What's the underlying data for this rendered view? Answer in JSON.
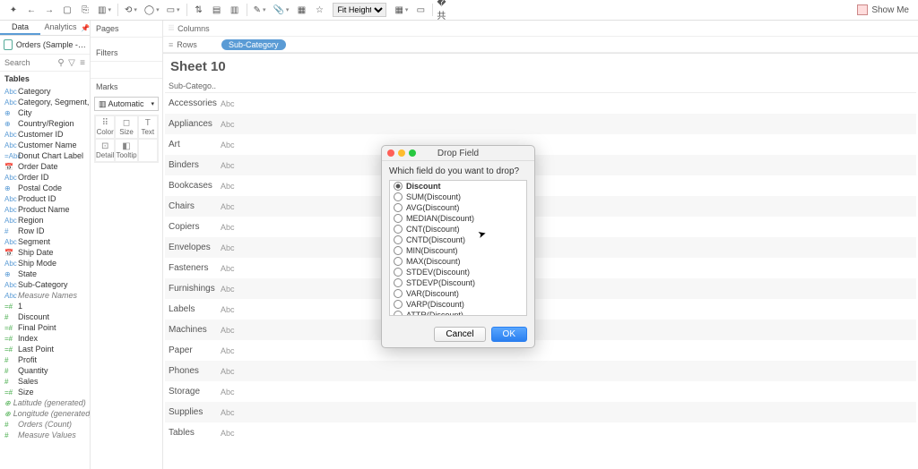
{
  "toolbar": {
    "fit_label": "Fit Height",
    "showme_label": "Show Me"
  },
  "side_tabs": {
    "data": "Data",
    "analytics": "Analytics"
  },
  "datasource": "Orders (Sample - Supe...",
  "search_placeholder": "Search",
  "tables_header": "Tables",
  "fields": [
    {
      "ic": "Abc",
      "t": "d",
      "n": "Category"
    },
    {
      "ic": "Abc",
      "t": "d",
      "n": "Category, Segment, Sub..."
    },
    {
      "ic": "⊕",
      "t": "geo",
      "n": "City"
    },
    {
      "ic": "⊕",
      "t": "geo",
      "n": "Country/Region"
    },
    {
      "ic": "Abc",
      "t": "d",
      "n": "Customer ID"
    },
    {
      "ic": "Abc",
      "t": "d",
      "n": "Customer Name"
    },
    {
      "ic": "=Abc",
      "t": "d",
      "n": "Donut Chart Label"
    },
    {
      "ic": "📅",
      "t": "d",
      "n": "Order Date"
    },
    {
      "ic": "Abc",
      "t": "d",
      "n": "Order ID"
    },
    {
      "ic": "⊕",
      "t": "geo",
      "n": "Postal Code"
    },
    {
      "ic": "Abc",
      "t": "d",
      "n": "Product ID"
    },
    {
      "ic": "Abc",
      "t": "d",
      "n": "Product Name"
    },
    {
      "ic": "Abc",
      "t": "d",
      "n": "Region"
    },
    {
      "ic": "#",
      "t": "d",
      "n": "Row ID"
    },
    {
      "ic": "Abc",
      "t": "d",
      "n": "Segment"
    },
    {
      "ic": "📅",
      "t": "d",
      "n": "Ship Date"
    },
    {
      "ic": "Abc",
      "t": "d",
      "n": "Ship Mode"
    },
    {
      "ic": "⊕",
      "t": "geo",
      "n": "State"
    },
    {
      "ic": "Abc",
      "t": "d",
      "n": "Sub-Category"
    },
    {
      "ic": "Abc",
      "t": "d",
      "n": "Measure Names",
      "it": true
    },
    {
      "ic": "=#",
      "t": "m",
      "n": "1"
    },
    {
      "ic": "#",
      "t": "m",
      "n": "Discount"
    },
    {
      "ic": "=#",
      "t": "m",
      "n": "Final Point"
    },
    {
      "ic": "=#",
      "t": "m",
      "n": "Index"
    },
    {
      "ic": "=#",
      "t": "m",
      "n": "Last Point"
    },
    {
      "ic": "#",
      "t": "m",
      "n": "Profit"
    },
    {
      "ic": "#",
      "t": "m",
      "n": "Quantity"
    },
    {
      "ic": "#",
      "t": "m",
      "n": "Sales"
    },
    {
      "ic": "=#",
      "t": "m",
      "n": "Size"
    },
    {
      "ic": "⊕",
      "t": "m",
      "n": "Latitude (generated)",
      "it": true
    },
    {
      "ic": "⊕",
      "t": "m",
      "n": "Longitude (generated)",
      "it": true
    },
    {
      "ic": "#",
      "t": "m",
      "n": "Orders (Count)",
      "it": true
    },
    {
      "ic": "#",
      "t": "m",
      "n": "Measure Values",
      "it": true
    }
  ],
  "pages_label": "Pages",
  "filters_label": "Filters",
  "marks_label": "Marks",
  "mark_type": "Automatic",
  "mark_cells": [
    {
      "i": "⠿",
      "l": "Color"
    },
    {
      "i": "◻",
      "l": "Size"
    },
    {
      "i": "T",
      "l": "Text"
    },
    {
      "i": "⊡",
      "l": "Detail"
    },
    {
      "i": "◧",
      "l": "Tooltip"
    },
    {
      "i": "",
      "l": ""
    }
  ],
  "columns_label": "Columns",
  "rows_label": "Rows",
  "row_pill": "Sub-Category",
  "sheet_title": "Sheet 10",
  "view_header": "Sub-Catego..",
  "view_rows": [
    "Accessories",
    "Appliances",
    "Art",
    "Binders",
    "Bookcases",
    "Chairs",
    "Copiers",
    "Envelopes",
    "Fasteners",
    "Furnishings",
    "Labels",
    "Machines",
    "Paper",
    "Phones",
    "Storage",
    "Supplies",
    "Tables"
  ],
  "abc": "Abc",
  "dialog": {
    "title": "Drop Field",
    "question": "Which field do you want to drop?",
    "options": [
      {
        "n": "Discount",
        "b": true,
        "s": true
      },
      {
        "n": "SUM(Discount)"
      },
      {
        "n": "AVG(Discount)"
      },
      {
        "n": "MEDIAN(Discount)"
      },
      {
        "n": "CNT(Discount)"
      },
      {
        "n": "CNTD(Discount)"
      },
      {
        "n": "MIN(Discount)"
      },
      {
        "n": "MAX(Discount)"
      },
      {
        "n": "STDEV(Discount)"
      },
      {
        "n": "STDEVP(Discount)"
      },
      {
        "n": "VAR(Discount)"
      },
      {
        "n": "VARP(Discount)"
      },
      {
        "n": "ATTR(Discount)"
      }
    ],
    "cancel": "Cancel",
    "ok": "OK"
  }
}
